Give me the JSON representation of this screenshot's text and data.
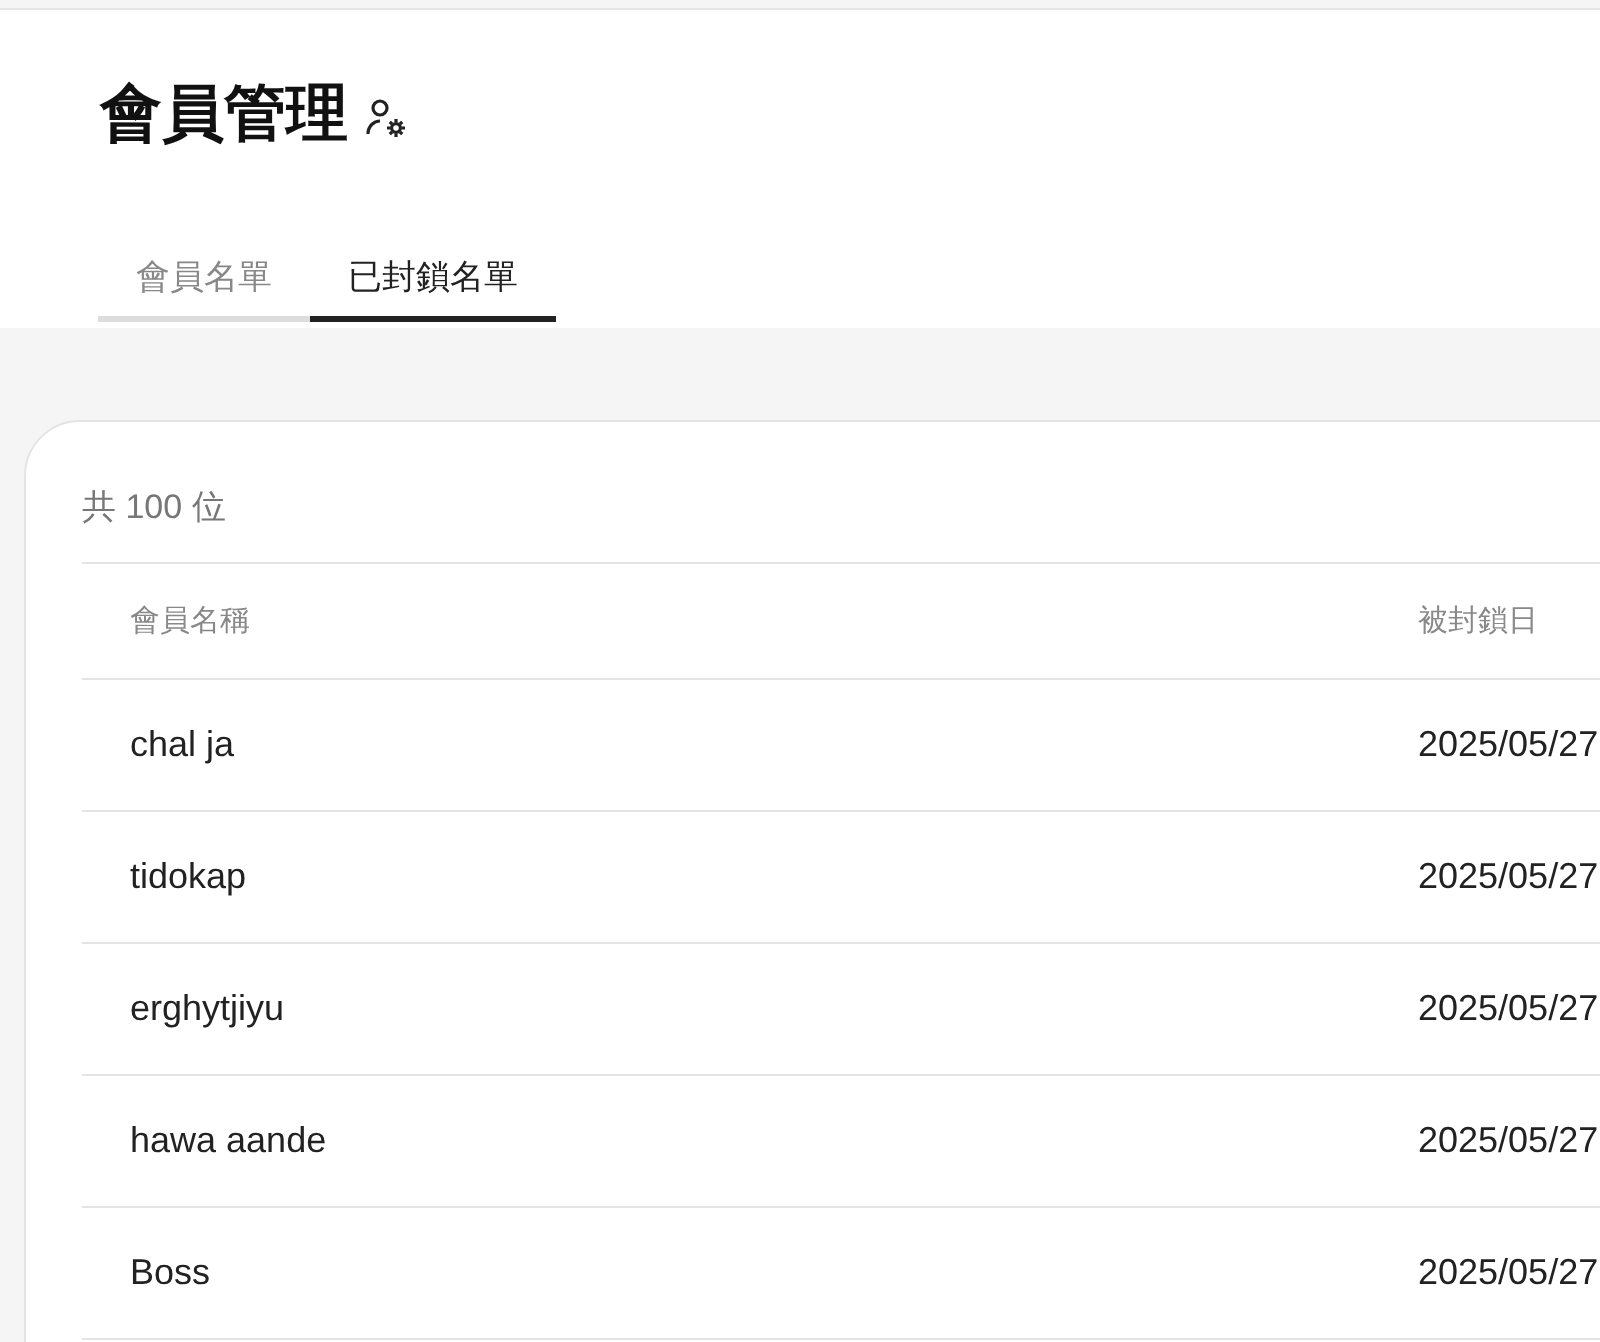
{
  "page": {
    "title": "會員管理"
  },
  "tabs": [
    {
      "label": "會員名單",
      "selected": false
    },
    {
      "label": "已封鎖名單",
      "selected": true
    }
  ],
  "summary": "共 100 位",
  "table": {
    "columns": [
      "會員名稱",
      "被封鎖日"
    ],
    "rows": [
      [
        "chal ja",
        "2025/05/27"
      ],
      [
        "tidokap",
        "2025/05/27"
      ],
      [
        "erghytjiyu",
        "2025/05/27"
      ],
      [
        "hawa aande",
        "2025/05/27"
      ],
      [
        "Boss",
        "2025/05/27"
      ]
    ]
  }
}
